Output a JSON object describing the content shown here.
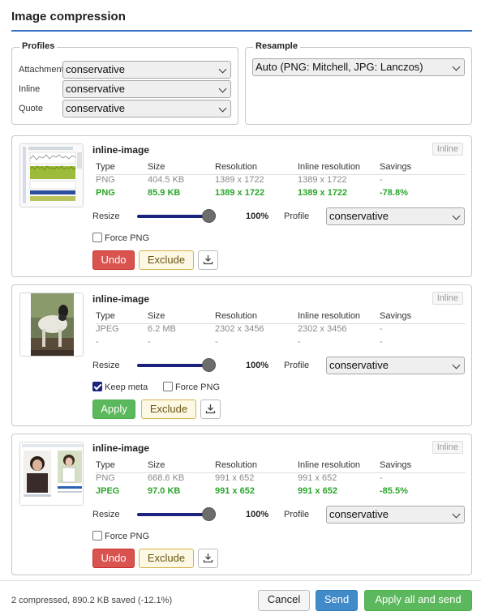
{
  "dialog": {
    "title": "Image compression"
  },
  "profiles": {
    "legend": "Profiles",
    "rows": [
      {
        "label": "Attachment",
        "value": "conservative"
      },
      {
        "label": "Inline",
        "value": "conservative"
      },
      {
        "label": "Quote",
        "value": "conservative"
      }
    ]
  },
  "resample": {
    "legend": "Resample",
    "value": "Auto (PNG: Mitchell, JPG: Lanczos)"
  },
  "table_headers": [
    "Type",
    "Size",
    "Resolution",
    "Inline resolution",
    "Savings"
  ],
  "cards": [
    {
      "title": "inline-image",
      "badge": "Inline",
      "original": [
        "PNG",
        "404.5 KB",
        "1389 x 1722",
        "1389 x 1722",
        "-"
      ],
      "compressed": [
        "PNG",
        "85.9 KB",
        "1389 x 1722",
        "1389 x 1722",
        "-78.8%"
      ],
      "resize_label": "Resize",
      "resize_value": 1.0,
      "resize_text": "100%",
      "profile_label": "Profile",
      "profile": "conservative",
      "checkboxes": [
        {
          "label": "Force PNG",
          "checked": false
        }
      ],
      "primary_button": "Undo",
      "exclude_button": "Exclude"
    },
    {
      "title": "inline-image",
      "badge": "Inline",
      "original": [
        "JPEG",
        "6.2 MB",
        "2302 x 3456",
        "2302 x 3456",
        "-"
      ],
      "compressed": [
        "-",
        "-",
        "-",
        "-",
        "-"
      ],
      "resize_label": "Resize",
      "resize_value": 1.0,
      "resize_text": "100%",
      "profile_label": "Profile",
      "profile": "conservative",
      "checkboxes": [
        {
          "label": "Keep meta",
          "checked": true
        },
        {
          "label": "Force PNG",
          "checked": false
        }
      ],
      "primary_button": "Apply",
      "exclude_button": "Exclude"
    },
    {
      "title": "inline-image",
      "badge": "Inline",
      "original": [
        "PNG",
        "668.6 KB",
        "991 x 652",
        "991 x 652",
        "-"
      ],
      "compressed": [
        "JPEG",
        "97.0 KB",
        "991 x 652",
        "991 x 652",
        "-85.5%"
      ],
      "resize_label": "Resize",
      "resize_value": 1.0,
      "resize_text": "100%",
      "profile_label": "Profile",
      "profile": "conservative",
      "checkboxes": [
        {
          "label": "Force PNG",
          "checked": false
        }
      ],
      "primary_button": "Undo",
      "exclude_button": "Exclude"
    }
  ],
  "footer": {
    "status": "2 compressed, 890.2 KB saved (-12.1%)",
    "cancel": "Cancel",
    "send": "Send",
    "apply_all": "Apply all and send"
  },
  "icons": {
    "download": "download-icon",
    "chevron": "chevron-down-icon"
  },
  "colors": {
    "accent": "#3a72c4",
    "savings": "#2aa62a",
    "undo": "#d9534f",
    "apply": "#5cb85c",
    "slider": "#1a237e"
  }
}
